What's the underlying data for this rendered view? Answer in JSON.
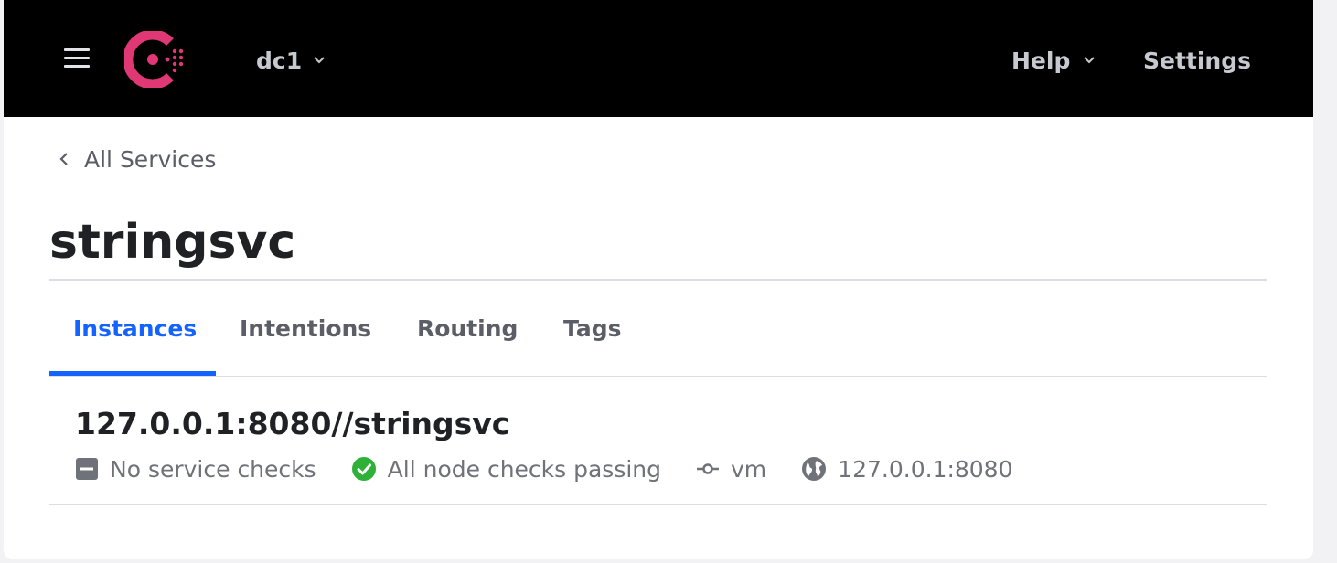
{
  "topbar": {
    "datacenter": "dc1",
    "help_label": "Help",
    "settings_label": "Settings"
  },
  "breadcrumb": {
    "label": "All Services"
  },
  "service": {
    "name": "stringsvc"
  },
  "tabs": [
    {
      "label": "Instances",
      "active": true
    },
    {
      "label": "Intentions",
      "active": false
    },
    {
      "label": "Routing",
      "active": false
    },
    {
      "label": "Tags",
      "active": false
    }
  ],
  "instances": [
    {
      "name": "127.0.0.1:8080//stringsvc",
      "service_checks": "No service checks",
      "node_checks": "All node checks passing",
      "node": "vm",
      "address": "127.0.0.1:8080"
    }
  ],
  "icons": {
    "menu": "hamburger-icon",
    "logo": "consul-logo",
    "chevron": "chevron-down-icon",
    "back": "chevron-left-icon",
    "no_checks": "minus-square-icon",
    "passing": "check-circle-icon",
    "node": "node-icon",
    "address": "globe-icon"
  },
  "colors": {
    "brand": "#e03875",
    "accent": "#1563ff",
    "passing": "#2eb039",
    "topbar": "#000000"
  }
}
